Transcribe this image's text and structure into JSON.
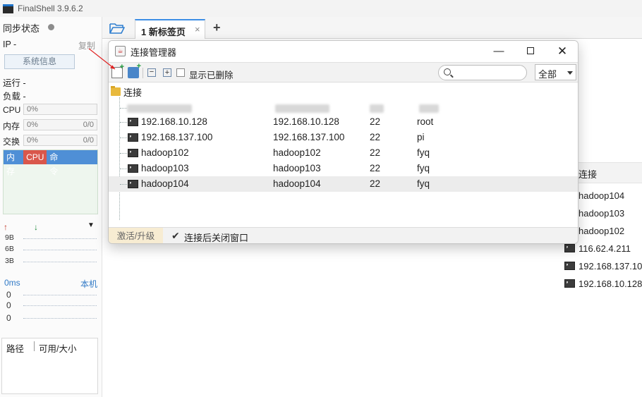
{
  "app": {
    "title": "FinalShell 3.9.6.2"
  },
  "sidebar": {
    "sync_label": "同步状态",
    "ip_label": "IP  -",
    "copy_label": "复制",
    "sysinfo_button": "系统信息",
    "run_label": "运行 -",
    "load_label": "负载 -",
    "cpu": {
      "label": "CPU",
      "value": "0%"
    },
    "mem": {
      "label": "内存",
      "value": "0%",
      "ratio": "0/0"
    },
    "swap": {
      "label": "交换",
      "value": "0%",
      "ratio": "0/0"
    },
    "chart_tabs": [
      "内存",
      "CPU",
      "命令"
    ],
    "net": {
      "up_icon": "arrow-up-icon",
      "down_icon": "arrow-down-icon",
      "levels": [
        "9B",
        "6B",
        "3B"
      ]
    },
    "ping": {
      "latency": "0ms",
      "target": "本机",
      "values": [
        "0",
        "0",
        "0"
      ]
    },
    "disk": {
      "col_path": "路径",
      "col_avail": "可用/大小"
    }
  },
  "tabs": {
    "new_tab_label": "1 新标签页",
    "close_glyph": "×",
    "add_glyph": "+"
  },
  "background_list": {
    "header": "连接",
    "items": [
      "hadoop104",
      "hadoop103",
      "hadoop102",
      "116.62.4.211",
      "192.168.137.10",
      "192.168.10.128"
    ]
  },
  "dialog": {
    "title": "连接管理器",
    "toolbar": {
      "show_deleted_label": "显示已删除",
      "search_placeholder": "",
      "filter_value": "全部"
    },
    "root_label": "连接",
    "rows": [
      {
        "name": "192.168.10.128",
        "host": "192.168.10.128",
        "port": "22",
        "user": "root"
      },
      {
        "name": "192.168.137.100",
        "host": "192.168.137.100",
        "port": "22",
        "user": "pi"
      },
      {
        "name": "hadoop102",
        "host": "hadoop102",
        "port": "22",
        "user": "fyq"
      },
      {
        "name": "hadoop103",
        "host": "hadoop103",
        "port": "22",
        "user": "fyq"
      },
      {
        "name": "hadoop104",
        "host": "hadoop104",
        "port": "22",
        "user": "fyq"
      }
    ],
    "status": {
      "activate_label": "激活/升级",
      "close_after_label": "连接后关闭窗口",
      "close_after_checked": true
    }
  },
  "colors": {
    "accent": "#3d8ee5",
    "cpu_tab": "#d9574b",
    "mem_tab": "#4f8fd6",
    "ping_text": "#3079c6"
  }
}
